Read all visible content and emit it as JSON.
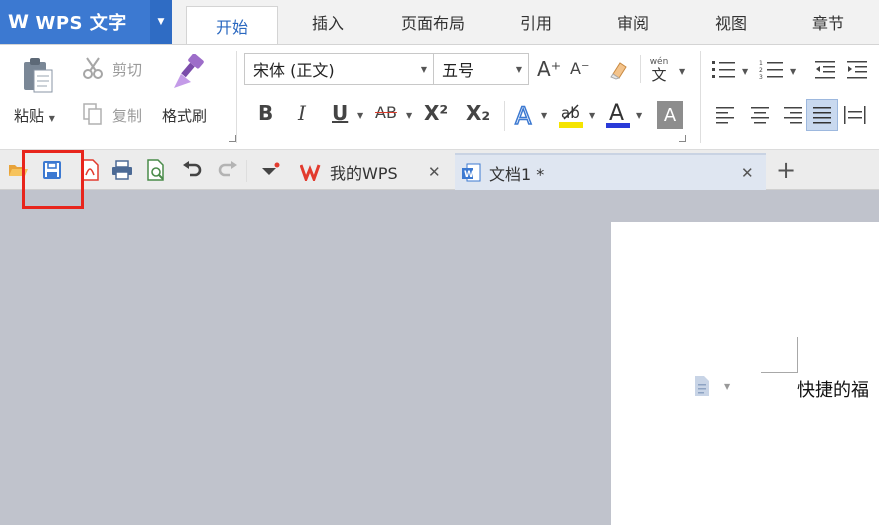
{
  "app": {
    "name": "WPS 文字"
  },
  "menu_tabs": [
    "开始",
    "插入",
    "页面布局",
    "引用",
    "审阅",
    "视图",
    "章节"
  ],
  "ribbon": {
    "paste": "粘贴",
    "cut": "剪切",
    "copy": "复制",
    "format_painter": "格式刷",
    "font_name": "宋体 (正文)",
    "font_size": "五号",
    "bold": "B",
    "italic": "I",
    "underline": "U",
    "strikethrough": "AB",
    "superscript": "X²",
    "subscript": "X₂",
    "grow_font": "A⁺",
    "shrink_font": "A⁻",
    "pinyin_top": "wén",
    "pinyin_char": "文"
  },
  "doc_tabs": [
    {
      "label": "我的WPS"
    },
    {
      "label": "文档1 *"
    }
  ],
  "document": {
    "text": "快捷的福"
  },
  "colors": {
    "accent": "#3c79d1",
    "highlight": "#e8251c",
    "highlight_yellow": "#f5e400",
    "font_red": "#d83b2b"
  }
}
